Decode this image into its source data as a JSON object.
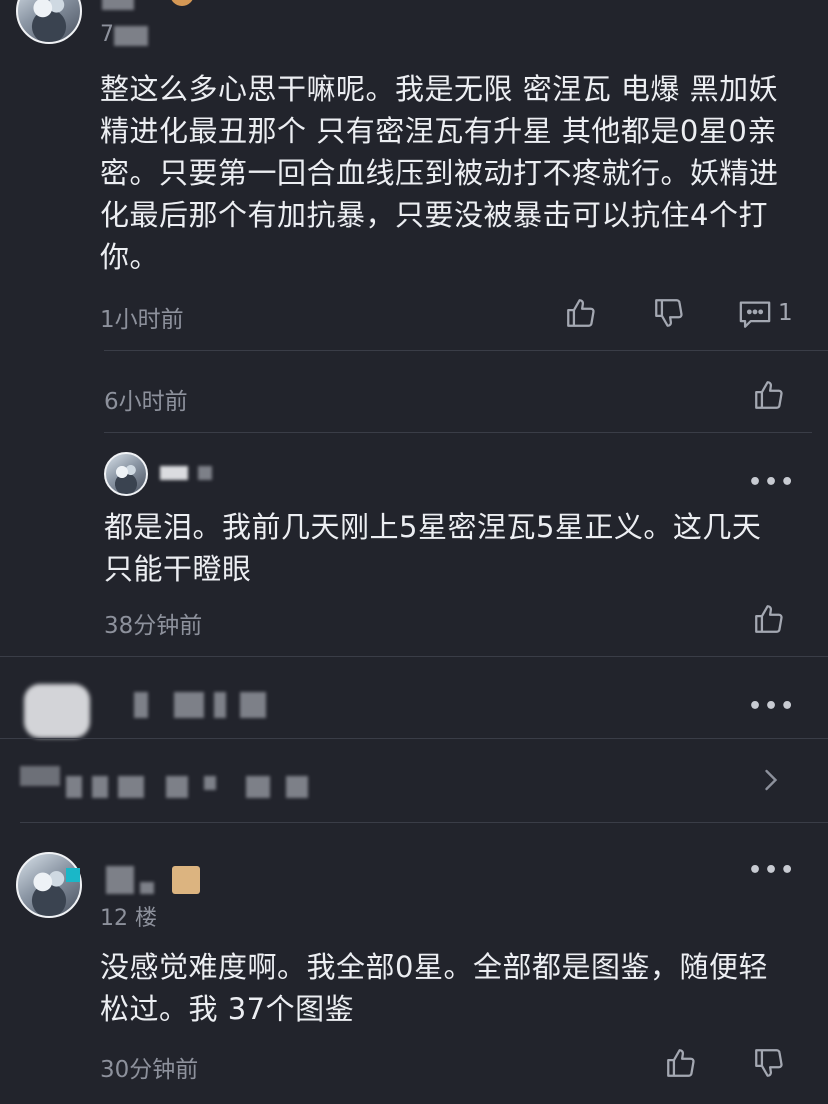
{
  "comment1": {
    "user_name": "",
    "floor": "7",
    "text": "整这么多心思干嘛呢。我是无限 密涅瓦 电爆 黑加妖精进化最丑那个 只有密涅瓦有升星 其他都是0星0亲密。只要第一回合血线压到被动打不疼就行。妖精进化最后那个有加抗暴，只要没被暴击可以抗住4个打你。",
    "time": "1小时前",
    "reply_count": "1"
  },
  "reply_section": {
    "time": "6小时前"
  },
  "reply1": {
    "user_name": "",
    "text": "都是泪。我前几天刚上5星密涅瓦5星正义。这几天只能干瞪眼",
    "time": "38分钟前"
  },
  "comment2": {
    "user_name": ""
  },
  "expand_row": {
    "text": "",
    "chevron": "chevron-right-icon"
  },
  "comment3": {
    "user_name": "",
    "floor": "12 楼",
    "text": "没感觉难度啊。我全部0星。全部都是图鉴，随便轻松过。我 37个图鉴",
    "time": "30分钟前"
  },
  "icons": {
    "more": "more-icon",
    "like": "thumbs-up-icon",
    "dislike": "thumbs-down-icon",
    "comment": "comment-icon"
  },
  "colors": {
    "background": "#22242c",
    "text": "#eceef2",
    "meta": "#8d919c",
    "divider": "#3a3d47"
  },
  "more_glyph": "•••"
}
